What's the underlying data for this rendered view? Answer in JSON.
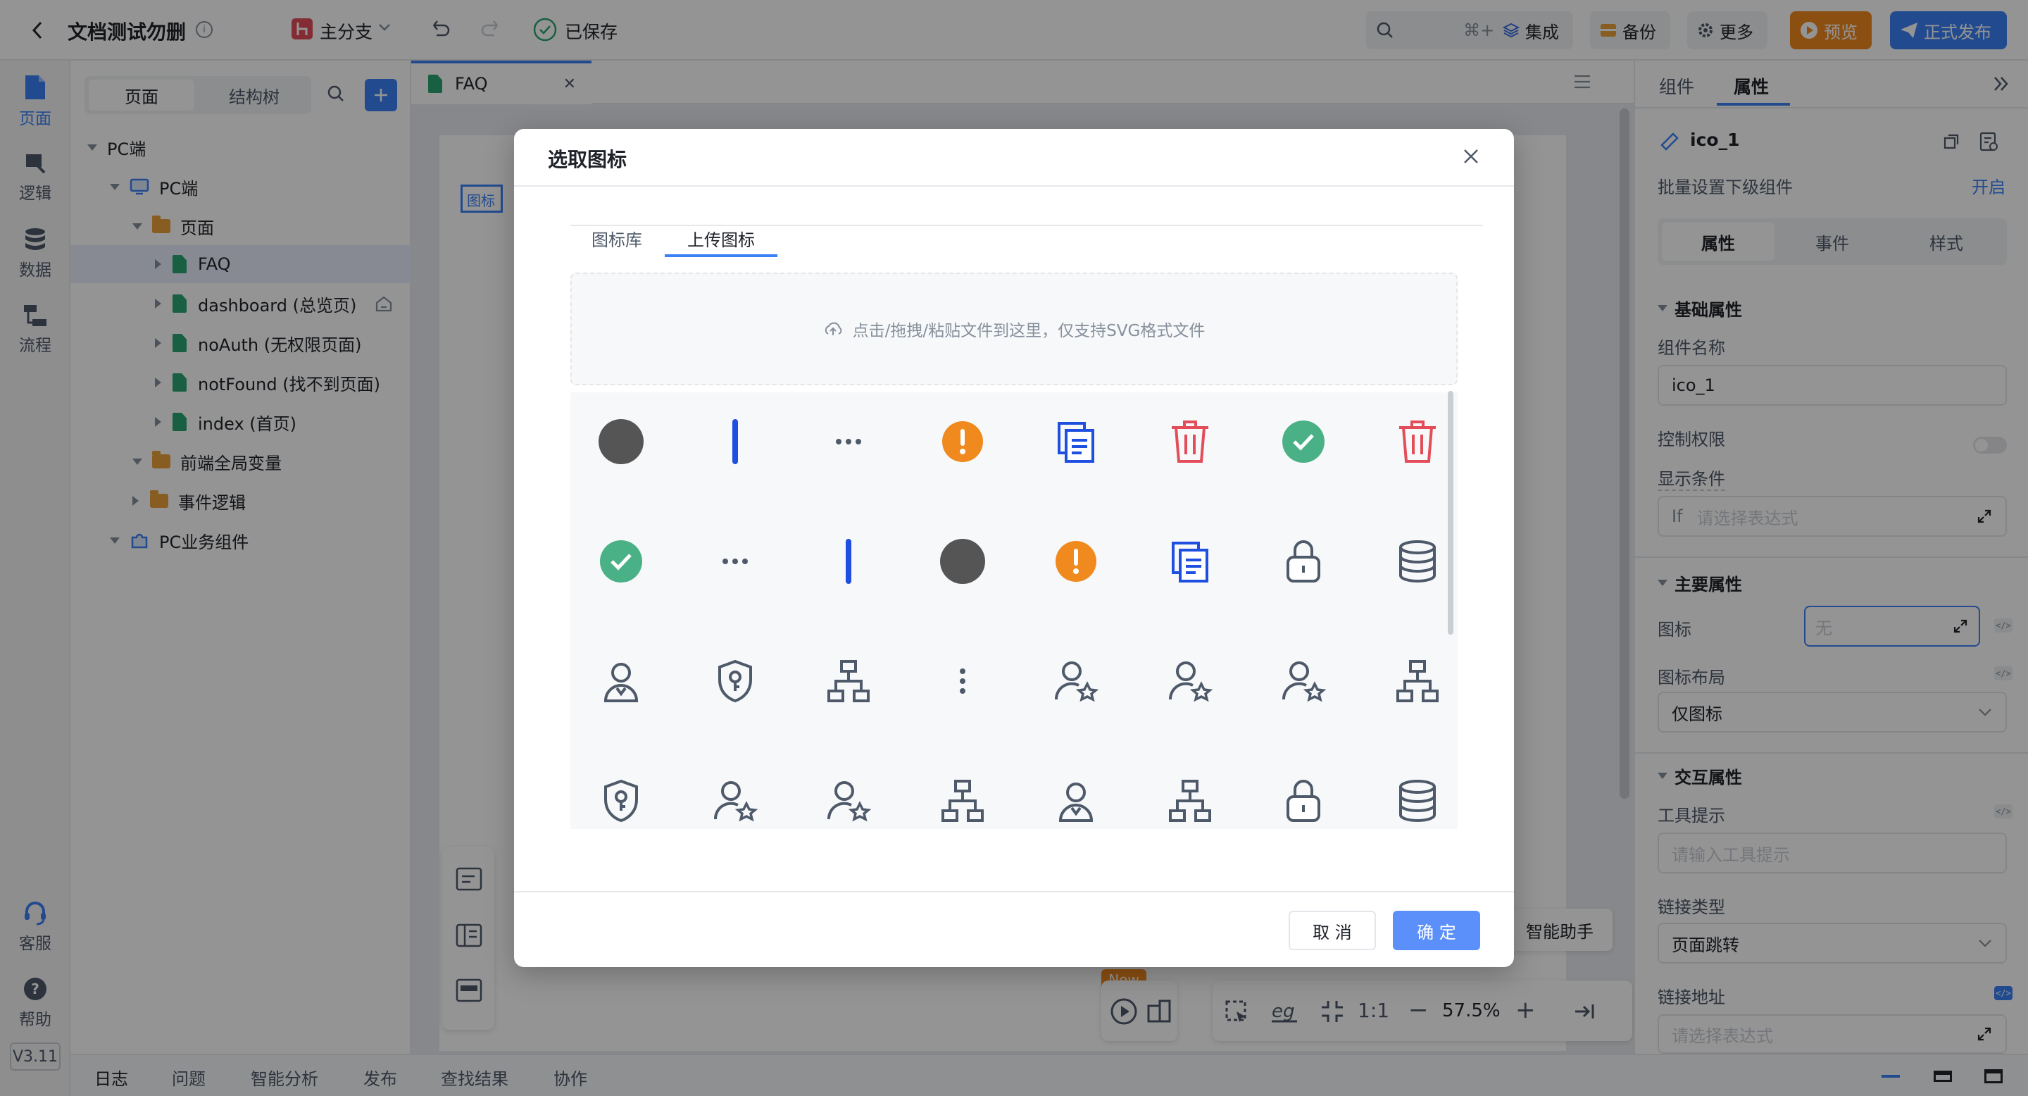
{
  "app": {
    "title": "文档测试勿删",
    "branch": "主分支",
    "saved": "已保存",
    "search_shortcut": "⌘+F",
    "actions": {
      "integrate": "集成",
      "backup": "备份",
      "more": "更多",
      "preview": "预览",
      "publish": "正式发布"
    }
  },
  "rail": {
    "items": [
      {
        "label": "页面",
        "icon": "page-icon"
      },
      {
        "label": "逻辑",
        "icon": "logic-icon"
      },
      {
        "label": "数据",
        "icon": "database-icon"
      },
      {
        "label": "流程",
        "icon": "flow-icon"
      }
    ],
    "service": "客服",
    "help": "帮助",
    "version": "V3.11"
  },
  "left_panel": {
    "tabs": [
      "页面",
      "结构树"
    ],
    "tree": [
      {
        "label": "PC端",
        "type": "root"
      },
      {
        "label": "PC端",
        "type": "device"
      },
      {
        "label": "页面",
        "type": "folder"
      },
      {
        "label": "FAQ",
        "type": "page"
      },
      {
        "label": "dashboard (总览页)",
        "type": "page"
      },
      {
        "label": "noAuth (无权限页面)",
        "type": "page"
      },
      {
        "label": "notFound (找不到页面)",
        "type": "page"
      },
      {
        "label": "index (首页)",
        "type": "page"
      },
      {
        "label": "前端全局变量",
        "type": "folder"
      },
      {
        "label": "事件逻辑",
        "type": "folder"
      },
      {
        "label": "PC业务组件",
        "type": "component"
      }
    ]
  },
  "editor": {
    "tab": "FAQ",
    "canvas_label": "图标",
    "assistant": "智能助手",
    "new_badge": "New",
    "zoom_ratio": "1:1",
    "zoom": "57.5%"
  },
  "right_panel": {
    "tabs": [
      "组件",
      "属性"
    ],
    "component_name": "ico_1",
    "batch_label": "批量设置下级组件",
    "batch_action": "开启",
    "subtabs": [
      "属性",
      "事件",
      "样式"
    ],
    "section_basic": "基础属性",
    "name_label": "组件名称",
    "name_value": "ico_1",
    "permission_label": "控制权限",
    "condition_label": "显示条件",
    "condition_prefix": "If",
    "condition_placeholder": "请选择表达式",
    "section_main": "主要属性",
    "icon_label": "图标",
    "icon_value": "无",
    "layout_label": "图标布局",
    "layout_value": "仅图标",
    "section_interaction": "交互属性",
    "tooltip_label": "工具提示",
    "tooltip_placeholder": "请输入工具提示",
    "link_type_label": "链接类型",
    "link_type_value": "页面跳转",
    "link_url_label": "链接地址",
    "link_url_placeholder": "请选择表达式"
  },
  "bottom_bar": {
    "tabs": [
      "日志",
      "问题",
      "智能分析",
      "发布",
      "查找结果",
      "协作"
    ]
  },
  "modal": {
    "title": "选取图标",
    "tabs": [
      "图标库",
      "上传图标"
    ],
    "active_tab": "上传图标",
    "upload_hint": "点击/拖拽/粘贴文件到这里，仅支持SVG格式文件",
    "cancel": "取 消",
    "confirm": "确 定",
    "icons": [
      "circle-filled-icon",
      "bar-icon",
      "more-horizontal-icon",
      "warning-icon",
      "copy-icon",
      "delete-red-icon",
      "check-circle-icon",
      "delete-red-icon",
      "check-circle-icon",
      "more-horizontal-icon",
      "bar-icon",
      "circle-filled-icon",
      "warning-icon",
      "copy-icon",
      "lock-icon",
      "database-icon",
      "user-icon",
      "shield-key-icon",
      "org-tree-icon",
      "more-vertical-icon",
      "user-star-icon",
      "user-star-icon",
      "user-star-icon",
      "org-tree-icon",
      "shield-key-icon",
      "user-star-icon",
      "user-star-icon",
      "org-tree-icon",
      "user-icon",
      "org-tree-icon",
      "lock-icon",
      "database-icon"
    ]
  },
  "colors": {
    "primary": "#3b82f6",
    "orange": "#f0891e",
    "green": "#2ba471",
    "red": "#e34d59",
    "dark": "#555555"
  }
}
